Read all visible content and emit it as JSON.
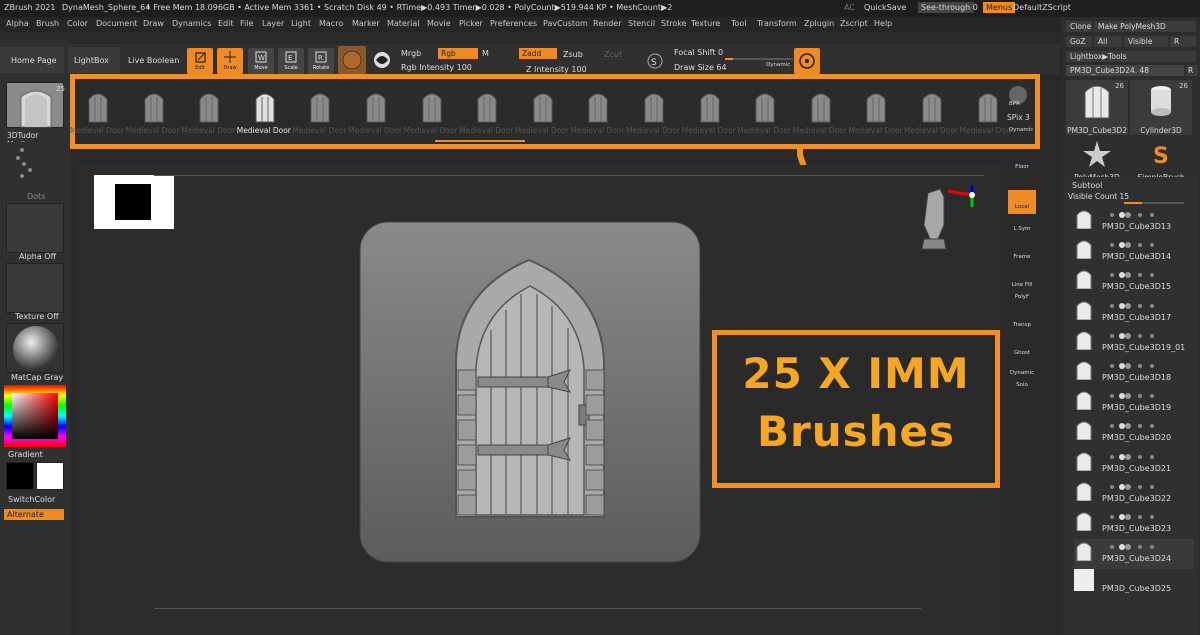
{
  "titlebar": {
    "app": "ZBrush 2021",
    "doc": "DynaMesh_Sphere_64",
    "stats": "• Free Mem 18.096GB • Active Mem 3361 • Scratch Disk 49 • RTime▶0.493 Timer▶0.028 • PolyCount▶519.944 KP • MeshCount▶2",
    "ac": "AC",
    "quicksave": "QuickSave",
    "seethrough": "See-through",
    "seethrough_val": "0",
    "menus": "Menus",
    "defaultzscript": "DefaultZScript"
  },
  "menubar": [
    "Alpha",
    "Brush",
    "Color",
    "Document",
    "Draw",
    "Dynamics",
    "Edit",
    "File",
    "Layer",
    "Light",
    "Macro",
    "Marker",
    "Material",
    "Movie",
    "Picker",
    "Preferences",
    "PavCustom",
    "Render",
    "Stencil",
    "Stroke",
    "Texture",
    "Tool",
    "Transform",
    "Zplugin",
    "Zscript",
    "Help"
  ],
  "shelf": {
    "home": "Home Page",
    "lightbox": "LightBox",
    "livebool": "Live Boolean",
    "tools": [
      {
        "label": "Edit",
        "active": true
      },
      {
        "label": "Draw",
        "active": true
      },
      {
        "label": "Move",
        "active": false
      },
      {
        "label": "Scale",
        "active": false
      },
      {
        "label": "Rotate",
        "active": false
      }
    ],
    "mrgb": "Mrgb",
    "rgb": "Rgb",
    "m": "M",
    "rgb_intensity": "Rgb Intensity 100",
    "zadd": "Zadd",
    "zsub": "Zsub",
    "zcut": "Zcut",
    "z_intensity": "Z Intensity 100",
    "focal_shift": "Focal Shift 0",
    "draw_size": "Draw Size 64",
    "dynamic": "Dynamic"
  },
  "lightbox": {
    "items": [
      "Medieval Door",
      "Medieval Door",
      "Medieval Door",
      "Medieval Door",
      "Medieval Door",
      "Medieval Door",
      "Medieval Door",
      "Medieval Door",
      "Medieval Door",
      "Medieval Door",
      "Medieval Door",
      "Medieval Door",
      "Medieval Door",
      "Medieval Door",
      "Medieval Door",
      "Medieval Door",
      "Medieval Door"
    ],
    "selected_index": 3,
    "bpr": "BPR",
    "spix": "SPix 3",
    "dynamic": "Dynamic"
  },
  "left": {
    "brush_name": "3DTudor Medieva",
    "brush_count": "25",
    "dots": "Dots",
    "alpha": "Alpha Off",
    "texture": "Texture Off",
    "matcap": "MatCap Gray",
    "gradient": "Gradient",
    "switchcolor": "SwitchColor",
    "alternate": "Alternate"
  },
  "rightstrip": [
    "Floor",
    "Local",
    "L.Sym",
    "Frame",
    "Line Fill",
    "PolyF",
    "Transp",
    "Ghost",
    "Dynamic",
    "Solo"
  ],
  "rightpanel": {
    "clone": "Clone",
    "make_polymesh": "Make PolyMesh3D",
    "goz": "GoZ",
    "all": "All",
    "visible": "Visible",
    "r": "R",
    "lightbox_tools": "Lightbox▶Tools",
    "current_tool": "PM3D_Cube3D24.",
    "current_tool_val": "48",
    "r2": "R",
    "tools": [
      {
        "name": "PM3D_Cube3D2",
        "count": "26"
      },
      {
        "name": "Cylinder3D",
        "count": "26"
      },
      {
        "name": "PolyMesh3D",
        "count": ""
      },
      {
        "name": "SimpleBrush",
        "count": ""
      }
    ],
    "subtool_title": "Subtool",
    "visible_count": "Visible Count 15",
    "subtools": [
      "PM3D_Cube3D13",
      "PM3D_Cube3D14",
      "PM3D_Cube3D15",
      "PM3D_Cube3D17",
      "PM3D_Cube3D19_01",
      "PM3D_Cube3D18",
      "PM3D_Cube3D19",
      "PM3D_Cube3D20",
      "PM3D_Cube3D21",
      "PM3D_Cube3D22",
      "PM3D_Cube3D23",
      "PM3D_Cube3D24",
      "PM3D_Cube3D25"
    ]
  },
  "callout": {
    "line1": "25 X IMM",
    "line2": "Brushes"
  },
  "colors": {
    "accent": "#f0902a",
    "bg": "#2a2a2a",
    "panel": "#303030",
    "text": "#f5a623"
  }
}
